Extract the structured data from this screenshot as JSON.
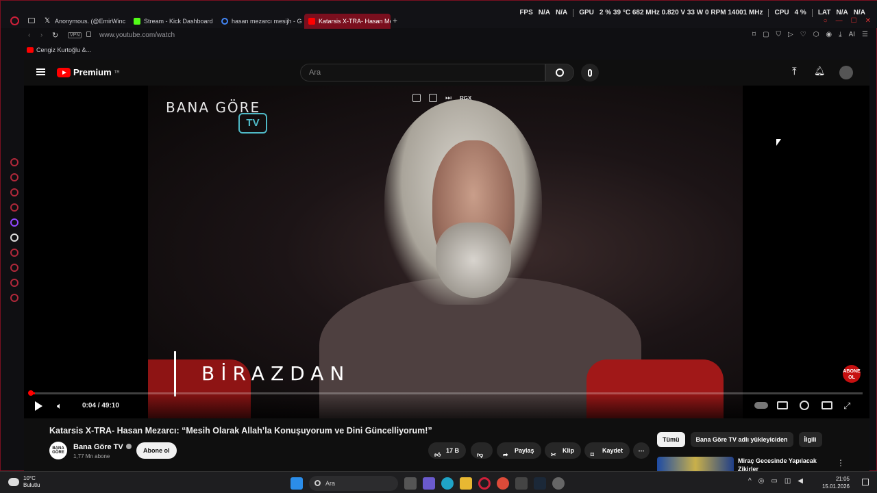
{
  "browser": {
    "tabs": [
      {
        "label": "Anonymous. (@EmirWinch",
        "color": "#ffffff"
      },
      {
        "label": "Stream - Kick Dashboard",
        "color": "#53fc18"
      },
      {
        "label": "hasan mezarcı mesijh - Go",
        "color": "#4285f4"
      },
      {
        "label": "Katarsis X-TRA- Hasan Me",
        "color": "#ff0000"
      }
    ],
    "hud": {
      "fps_label": "FPS",
      "fps_value": "N/A",
      "fps_value2": "N/A",
      "gpu_label": "GPU",
      "gpu_stats": "2 %  39 °C  682 MHz  0.820 V  33 W  0 RPM  14001 MHz",
      "cpu_label": "CPU",
      "cpu_value": "4 %",
      "lat_label": "LAT",
      "lat_value": "N/A",
      "lat_value2": "N/A"
    },
    "vpn_label": "VPN",
    "url": "www.youtube.com/watch",
    "bookmark": "Cengiz Kurtoğlu &...",
    "accent": "#7a0f1e"
  },
  "youtube": {
    "logo_text": "Premium",
    "logo_region": "TR",
    "search_placeholder": "Ara",
    "player": {
      "channel_overlay": "BANA GÖRE",
      "channel_tv": "TV",
      "overlay_text": "BİRAZDAN",
      "tool_label": "RGX",
      "abone_badge": "ABONE OL",
      "time": "0:04 / 49:10",
      "progress": 0.0014
    },
    "video_title": "Katarsis X-TRA- Hasan Mezarcı: “Mesih Olarak Allah’la Konuşuyorum ve Dini Güncelliyorum!”",
    "channel": {
      "avatar_text": "BANA GÖRE",
      "name": "Bana Göre TV",
      "subscribers": "1,77 Mn abone",
      "subscribe_label": "Abone ol"
    },
    "actions": {
      "likes": "17 B",
      "share": "Paylaş",
      "clip": "Klip",
      "save": "Kaydet"
    },
    "chips": [
      "Tümü",
      "Bana Göre TV adlı yükleyiciden",
      "İlgili"
    ],
    "recommendation_title": "Miraç Gecesinde Yapılacak Zikirler"
  },
  "taskbar": {
    "temperature": "10°C",
    "weather": "Bulutlu",
    "search": "Ara",
    "time": "21:05",
    "date": "15.01.2026"
  }
}
